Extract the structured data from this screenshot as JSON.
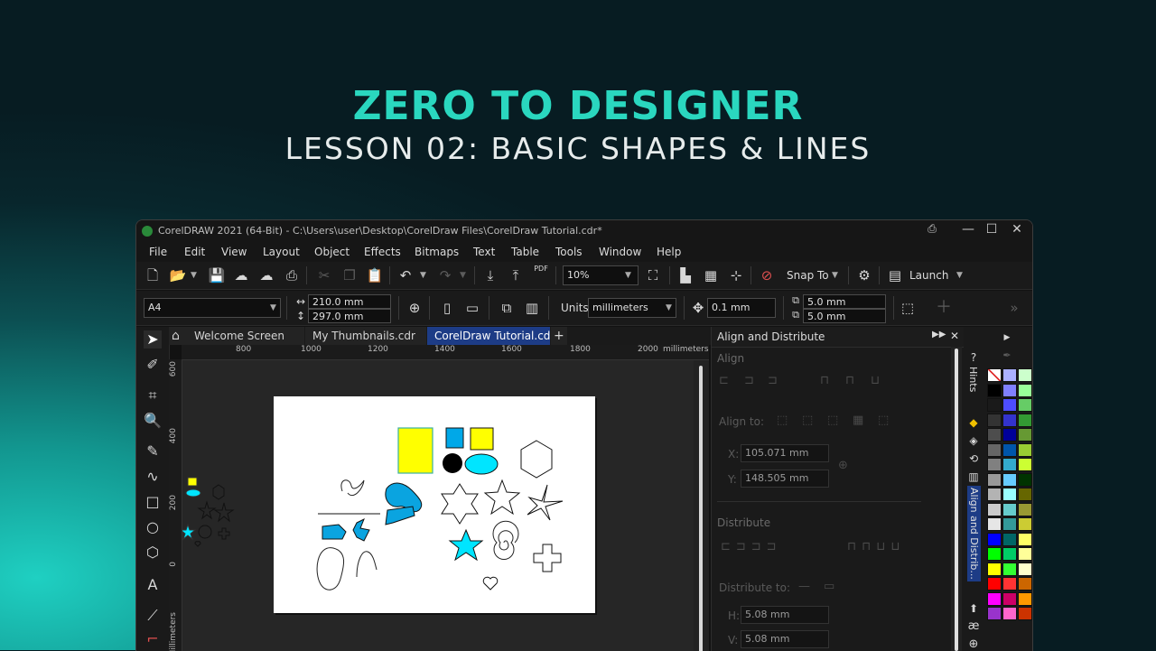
{
  "hero": {
    "title": "ZERO TO DESIGNER",
    "subtitle": "LESSON 02: BASIC SHAPES & LINES"
  },
  "window": {
    "title": "CorelDRAW 2021 (64-Bit) - C:\\Users\\user\\Desktop\\CorelDraw Files\\CorelDraw Tutorial.cdr*",
    "controls": {
      "minimize": "—",
      "maximize": "☐",
      "close": "✕"
    }
  },
  "menu": [
    "File",
    "Edit",
    "View",
    "Layout",
    "Object",
    "Effects",
    "Bitmaps",
    "Text",
    "Table",
    "Tools",
    "Window",
    "Help"
  ],
  "standard_toolbar": {
    "zoom_value": "10%",
    "snap_to_label": "Snap To",
    "launch_label": "Launch",
    "pdf_label": "PDF"
  },
  "property_bar": {
    "page_size": "A4",
    "width": "210.0 mm",
    "height": "297.0 mm",
    "units_label": "Units:",
    "units_value": "millimeters",
    "nudge": "0.1 mm",
    "dup_x": "5.0 mm",
    "dup_y": "5.0 mm"
  },
  "doc_tabs": [
    "Welcome Screen",
    "My Thumbnails.cdr",
    "CorelDraw Tutorial.cdr*"
  ],
  "ruler_h": {
    "ticks": [
      "800",
      "1000",
      "1200",
      "1400",
      "1600",
      "1800",
      "2000"
    ],
    "unit": "millimeters"
  },
  "ruler_v": {
    "ticks": [
      "600",
      "400",
      "200",
      "0"
    ],
    "unit": "Millimeters"
  },
  "docker": {
    "title": "Align and Distribute",
    "align_section": "Align",
    "align_to_label": "Align to:",
    "x_label": "X:",
    "x_value": "105.071 mm",
    "y_label": "Y:",
    "y_value": "148.505 mm",
    "distribute_section": "Distribute",
    "distribute_to_label": "Distribute to:",
    "h_label": "H:",
    "h_value": "5.08 mm",
    "v_label": "V:",
    "v_value": "5.08 mm"
  },
  "side_tabs": {
    "hints": "Hints",
    "align": "Align and Distrib..."
  },
  "colors": {
    "hero_title": "#2ad7bf",
    "accent_tab": "#1d3c86",
    "shape_yellow": "#ffff00",
    "shape_blue": "#00a8e8",
    "shape_cyan": "#00e5ff"
  }
}
